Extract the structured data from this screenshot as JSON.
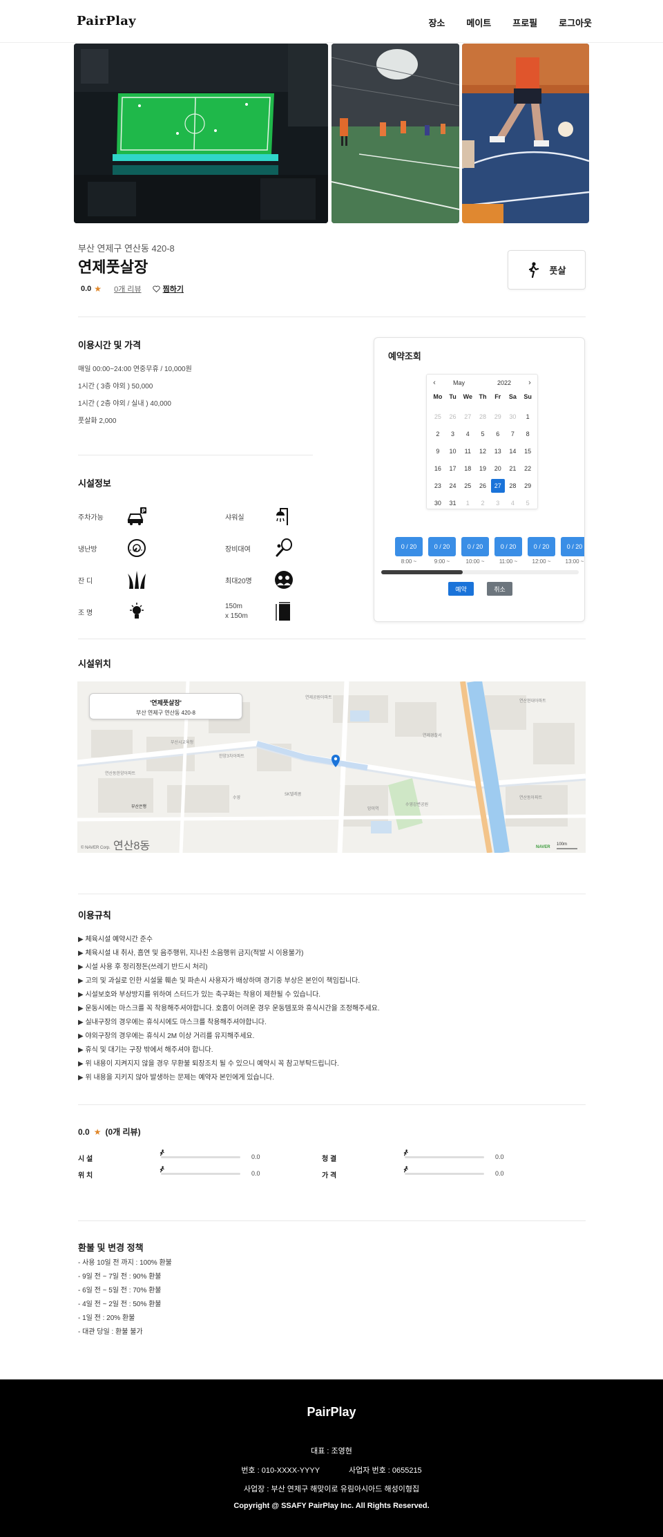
{
  "header": {
    "logo": "PairPlay",
    "nav": [
      "장소",
      "메이트",
      "프로필",
      "로그아웃"
    ]
  },
  "place": {
    "address": "부산 연제구 연산동 420-8",
    "name": "연제풋살장",
    "rating": "0.0",
    "review_link": "0개 리뷰",
    "favorite_label": "찜하기",
    "sport": "풋살"
  },
  "hours_section": {
    "title": "이용시간 및 가격",
    "lines": [
      "매일 00:00~24:00 연중무휴 / 10,000원",
      "1시간 ( 3층 야외 ) 50,000",
      "1시간 ( 2층 야외 / 실내 ) 40,000",
      "풋살화 2,000"
    ]
  },
  "facility_section": {
    "title": "시설정보",
    "items": [
      {
        "label": "주차가능",
        "icon": "parking-car-icon"
      },
      {
        "label": "샤워실",
        "icon": "shower-icon"
      },
      {
        "label": "냉난방",
        "icon": "thermostat-icon"
      },
      {
        "label": "장비대여",
        "icon": "racket-icon"
      },
      {
        "label": "잔 디",
        "icon": "grass-icon"
      },
      {
        "label": "최대20명",
        "icon": "people-icon"
      },
      {
        "label": "조 명",
        "icon": "light-bulb-icon"
      },
      {
        "label": "150m x 150m",
        "label_line1": "150m",
        "label_line2": "x 150m",
        "icon": "field-size-icon"
      }
    ]
  },
  "booking": {
    "title": "예약조회",
    "calendar": {
      "month": "May",
      "year": "2022",
      "weekdays": [
        "Mo",
        "Tu",
        "We",
        "Th",
        "Fr",
        "Sa",
        "Su"
      ],
      "days": [
        {
          "d": "25",
          "m": true
        },
        {
          "d": "26",
          "m": true
        },
        {
          "d": "27",
          "m": true
        },
        {
          "d": "28",
          "m": true
        },
        {
          "d": "29",
          "m": true
        },
        {
          "d": "30",
          "m": true
        },
        {
          "d": "1"
        },
        {
          "d": "2"
        },
        {
          "d": "3"
        },
        {
          "d": "4"
        },
        {
          "d": "5"
        },
        {
          "d": "6"
        },
        {
          "d": "7"
        },
        {
          "d": "8"
        },
        {
          "d": "9"
        },
        {
          "d": "10"
        },
        {
          "d": "11"
        },
        {
          "d": "12"
        },
        {
          "d": "13"
        },
        {
          "d": "14"
        },
        {
          "d": "15"
        },
        {
          "d": "16"
        },
        {
          "d": "17"
        },
        {
          "d": "18"
        },
        {
          "d": "19"
        },
        {
          "d": "20"
        },
        {
          "d": "21"
        },
        {
          "d": "22"
        },
        {
          "d": "23"
        },
        {
          "d": "24"
        },
        {
          "d": "25"
        },
        {
          "d": "26"
        },
        {
          "d": "27",
          "sel": true
        },
        {
          "d": "28"
        },
        {
          "d": "29"
        },
        {
          "d": "30"
        },
        {
          "d": "31"
        },
        {
          "d": "1",
          "m": true
        },
        {
          "d": "2",
          "m": true
        },
        {
          "d": "3",
          "m": true
        },
        {
          "d": "4",
          "m": true
        },
        {
          "d": "5",
          "m": true
        }
      ]
    },
    "slots": [
      {
        "count": "0 / 20",
        "time": "8:00 ~"
      },
      {
        "count": "0 / 20",
        "time": "9:00 ~"
      },
      {
        "count": "0 / 20",
        "time": "10:00 ~"
      },
      {
        "count": "0 / 20",
        "time": "11:00 ~"
      },
      {
        "count": "0 / 20",
        "time": "12:00 ~"
      },
      {
        "count": "0 / 20",
        "time": "13:00 ~"
      }
    ],
    "reserve_label": "예약",
    "cancel_label": "취소"
  },
  "location": {
    "title": "시설위치",
    "popup_name": "'연제풋살장'",
    "popup_address": "부산 연제구 연산동 420-8",
    "district": "연산8동",
    "copyright": "© NAVER Corp.",
    "scale": "100m",
    "brand": "NAVER",
    "labels": [
      "한양아파트",
      "현대아파트",
      "연제공원",
      "연산역",
      "수영강변공원",
      "연산동",
      "SK텔레콤",
      "부산은행"
    ]
  },
  "rules": {
    "title": "이용규칙",
    "items": [
      "▶ 체육시설 예약시간 준수",
      "▶ 체육시설 내 취사, 흡연 및 음주행위, 지나친 소음행위 금지(적발 시 이용불가)",
      "▶ 시설 사용 후 정리정돈(쓰레기 반드시 처리)",
      "▶ 고의 및 과실로 인한 시설물 훼손 및 파손시 사용자가 배상하며 경기중 부상은 본인이 책임집니다.",
      "▶ 시설보호와 부상방지를 위하여 스터드가 있는 축구화는 착용이 제한될 수 있습니다.",
      "▶ 운동시에는 마스크를 꼭 착용해주셔야합니다. 호흡이 어려운 경우 운동템포와 휴식시간을 조정해주세요.",
      "▶ 실내구장의 경우에는 휴식시에도 마스크를 착용해주셔야합니다.",
      "▶ 야외구장의 경우에는 휴식시 2M 이상 거리를 유지해주세요.",
      "▶ 휴식 및 대기는 구장 밖에서 해주셔야 합니다.",
      "▶ 위 내용이 지켜지지 않을 경우 무환불 퇴장조치 될 수 있으니 예약시 꼭 참고부탁드립니다.",
      "▶ 위 내용을 지키지 않아 발생하는 문제는 예약자 본인에게 있습니다."
    ]
  },
  "reviews": {
    "score": "0.0",
    "count_label": "(0개 리뷰)",
    "items": [
      {
        "label": "시 설",
        "value": "0.0",
        "fraction": 0
      },
      {
        "label": "청 결",
        "value": "0.0",
        "fraction": 0
      },
      {
        "label": "위 치",
        "value": "0.0",
        "fraction": 0
      },
      {
        "label": "가 격",
        "value": "0.0",
        "fraction": 0
      }
    ]
  },
  "refund": {
    "title": "환불 및 변경 정책",
    "items": [
      "- 사용 10일 전 까지 : 100% 환불",
      "- 9일 전 ~ 7일 전 : 90% 환불",
      "- 6일 전 ~ 5일 전 : 70% 환불",
      "- 4일 전 ~ 2일 전 : 50% 환불",
      "- 1일 전 : 20% 환불",
      "- 대관 당일 : 환불 불가"
    ]
  },
  "footer": {
    "logo": "PairPlay",
    "ceo": "대표 : 조영현",
    "phone": "번호 : 010-XXXX-YYYY",
    "biz_no": "사업자 번호 : 0655215",
    "address": "사업장 : 부산 연제구 해맞이로 유림아시아드 해성이형집",
    "copyright": "Copyright @ SSAFY PairPlay Inc. All Rights Reserved."
  },
  "colors": {
    "primary": "#1a73d9",
    "slot": "#3a8ee6",
    "star": "#e0872a",
    "cancel": "#6c757d",
    "footer_bg": "#000000"
  }
}
